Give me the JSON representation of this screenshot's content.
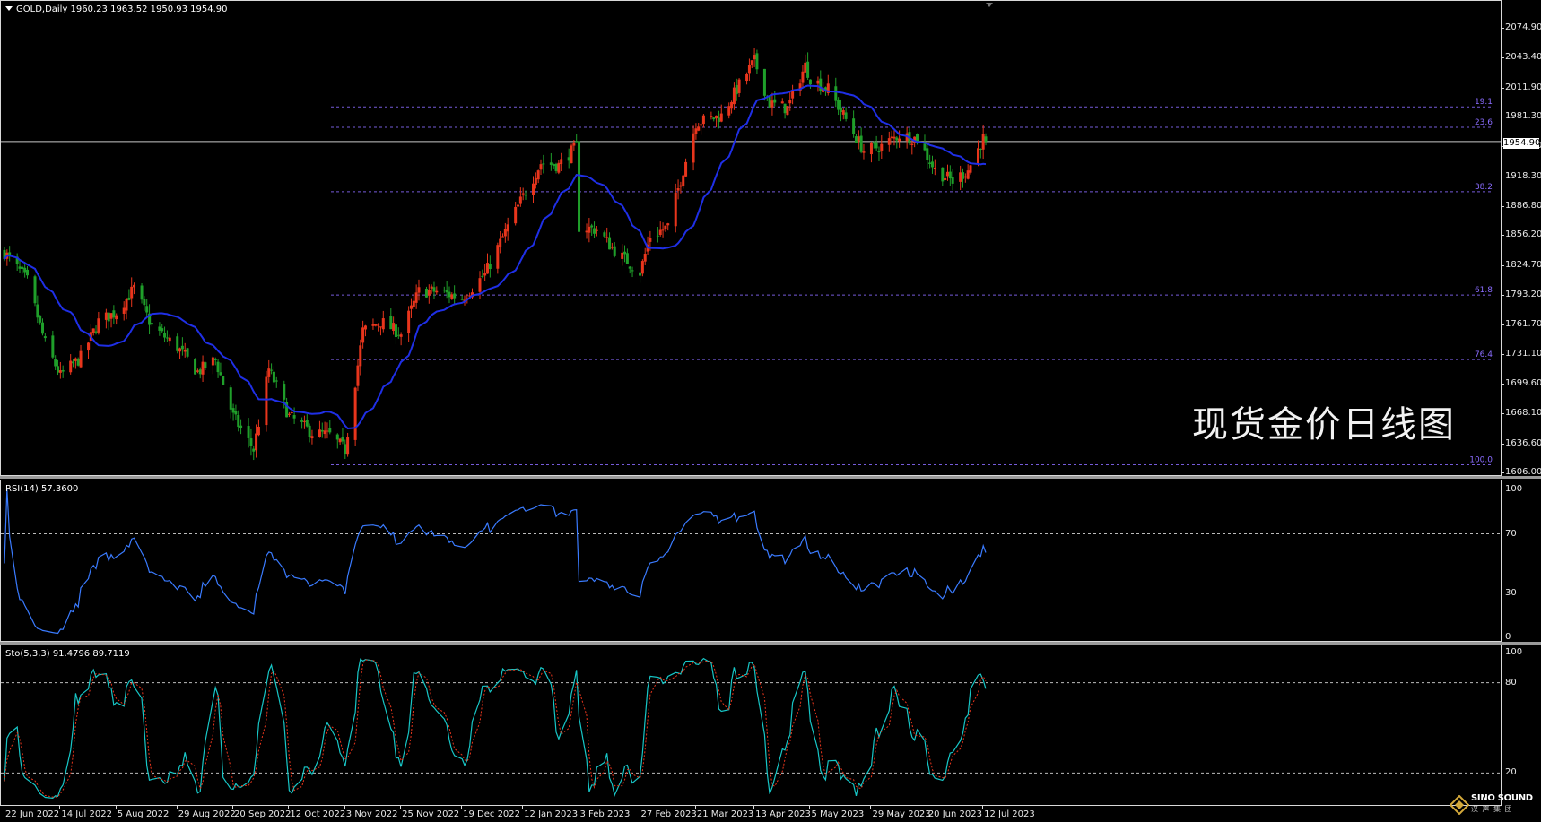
{
  "symbol_label": "GOLD,Daily  1960.23 1963.52 1950.93 1954.90",
  "watermark": "现货金价日线图",
  "current_price": "1954.90",
  "colors": {
    "up": "#e8351c",
    "down": "#1f9f2a",
    "ma": "#1f2fe6",
    "fib": "#8a6cff",
    "rsi": "#3a7bff",
    "sto_main": "#17c6c6",
    "sto_signal": "#e8351c"
  },
  "price_axis": [
    "2074.90",
    "2043.40",
    "2011.90",
    "1981.30",
    "1949.70",
    "1918.30",
    "1886.80",
    "1856.20",
    "1824.70",
    "1793.20",
    "1761.70",
    "1731.10",
    "1699.60",
    "1668.10",
    "1636.60",
    "1606.00"
  ],
  "fib_levels": [
    {
      "label": "19.1",
      "price": 1991.5
    },
    {
      "label": "23.6",
      "price": 1970.0
    },
    {
      "label": "38.2",
      "price": 1902.0
    },
    {
      "label": "61.8",
      "price": 1793.0
    },
    {
      "label": "76.4",
      "price": 1725.0
    },
    {
      "label": "100.0",
      "price": 1614.0
    }
  ],
  "rsi": {
    "label": "RSI(14) 57.3600",
    "axis": [
      "100",
      "70",
      "30",
      "0"
    ],
    "levels": [
      70,
      30
    ]
  },
  "sto": {
    "label": "Sto(5,3,3) 91.4796 89.7119",
    "axis": [
      "100",
      "80",
      "20"
    ],
    "levels": [
      80,
      20
    ]
  },
  "x_axis": [
    "22 Jun 2022",
    "14 Jul 2022",
    "5 Aug 2022",
    "29 Aug 2022",
    "20 Sep 2022",
    "12 Oct 2022",
    "3 Nov 2022",
    "25 Nov 2022",
    "19 Dec 2022",
    "12 Jan 2023",
    "3 Feb 2023",
    "27 Feb 2023",
    "21 Mar 2023",
    "13 Apr 2023",
    "5 May 2023",
    "29 May 2023",
    "20 Jun 2023",
    "12 Jul 2023"
  ],
  "logo": {
    "name": "SINO SOUND",
    "sub": "汉 声 集 团"
  },
  "chart_data": {
    "type": "candlestick",
    "title": "GOLD,Daily",
    "x_range": [
      "22 Jun 2022",
      "13 Jul 2023"
    ],
    "ylim": [
      1606.0,
      2090.0
    ],
    "close_path": [
      [
        "22 Jun 2022",
        1838
      ],
      [
        "1 Jul 2022",
        1808
      ],
      [
        "8 Jul 2022",
        1742
      ],
      [
        "14 Jul 2022",
        1708
      ],
      [
        "22 Jul 2022",
        1727
      ],
      [
        "29 Jul 2022",
        1765
      ],
      [
        "5 Aug 2022",
        1775
      ],
      [
        "12 Aug 2022",
        1800
      ],
      [
        "19 Aug 2022",
        1760
      ],
      [
        "29 Aug 2022",
        1738
      ],
      [
        "6 Sep 2022",
        1712
      ],
      [
        "13 Sep 2022",
        1725
      ],
      [
        "20 Sep 2022",
        1665
      ],
      [
        "28 Sep 2022",
        1630
      ],
      [
        "4 Oct 2022",
        1715
      ],
      [
        "12 Oct 2022",
        1665
      ],
      [
        "21 Oct 2022",
        1648
      ],
      [
        "28 Oct 2022",
        1645
      ],
      [
        "3 Nov 2022",
        1630
      ],
      [
        "10 Nov 2022",
        1755
      ],
      [
        "17 Nov 2022",
        1765
      ],
      [
        "25 Nov 2022",
        1752
      ],
      [
        "2 Dec 2022",
        1797
      ],
      [
        "9 Dec 2022",
        1797
      ],
      [
        "19 Dec 2022",
        1790
      ],
      [
        "28 Dec 2022",
        1815
      ],
      [
        "6 Jan 2023",
        1865
      ],
      [
        "12 Jan 2023",
        1897
      ],
      [
        "19 Jan 2023",
        1932
      ],
      [
        "26 Jan 2023",
        1930
      ],
      [
        "2 Feb 2023",
        1950
      ],
      [
        "3 Feb 2023",
        1865
      ],
      [
        "10 Feb 2023",
        1862
      ],
      [
        "17 Feb 2023",
        1840
      ],
      [
        "27 Feb 2023",
        1817
      ],
      [
        "3 Mar 2023",
        1855
      ],
      [
        "10 Mar 2023",
        1865
      ],
      [
        "16 Mar 2023",
        1925
      ],
      [
        "21 Mar 2023",
        1975
      ],
      [
        "31 Mar 2023",
        1982
      ],
      [
        "6 Apr 2023",
        2010
      ],
      [
        "13 Apr 2023",
        2040
      ],
      [
        "19 Apr 2023",
        1995
      ],
      [
        "26 Apr 2023",
        1990
      ],
      [
        "3 May 2023",
        2035
      ],
      [
        "5 May 2023",
        2022
      ],
      [
        "12 May 2023",
        2010
      ],
      [
        "19 May 2023",
        1978
      ],
      [
        "26 May 2023",
        1945
      ],
      [
        "2 Jun 2023",
        1950
      ],
      [
        "9 Jun 2023",
        1962
      ],
      [
        "16 Jun 2023",
        1958
      ],
      [
        "23 Jun 2023",
        1925
      ],
      [
        "30 Jun 2023",
        1913
      ],
      [
        "6 Jul 2023",
        1925
      ],
      [
        "12 Jul 2023",
        1958
      ],
      [
        "13 Jul 2023",
        1955
      ]
    ],
    "last_bar": {
      "open": 1960.23,
      "high": 1963.52,
      "low": 1950.93,
      "close": 1954.9
    }
  }
}
